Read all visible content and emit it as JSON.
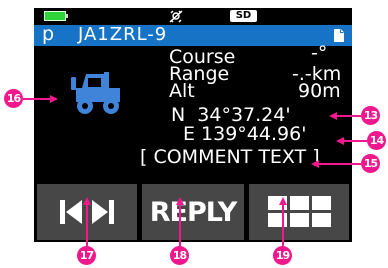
{
  "status_bar": {
    "battery_icon": "battery-full-icon",
    "battery_color": "#2fd33a",
    "gps_icon": "gps-off-icon",
    "sd_label": "SD"
  },
  "title_bar": {
    "background": "#1673c6",
    "symbol": "p",
    "callsign": "JA1ZRL-9",
    "document_icon": "document-icon"
  },
  "station": {
    "icon": "jeep-icon",
    "icon_color": "#3f84d8",
    "course_label": "Course",
    "course_value": "-°",
    "range_label": "Range",
    "range_value": "-.-km",
    "alt_label": "Alt",
    "alt_value": "90m",
    "latitude": "N  34°37.24'",
    "longitude": "E 139°44.96'",
    "comment": "[ COMMENT TEXT ]"
  },
  "buttons": {
    "nav_icon": "skip-prev-next-icon",
    "reply_label": "REPLY",
    "menu_icon": "grid-menu-icon",
    "background": "#474747"
  },
  "callouts": {
    "c13": "13",
    "c14": "14",
    "c15": "15",
    "c16": "16",
    "c17": "17",
    "c18": "18",
    "c19": "19",
    "color": "#f0188c"
  }
}
